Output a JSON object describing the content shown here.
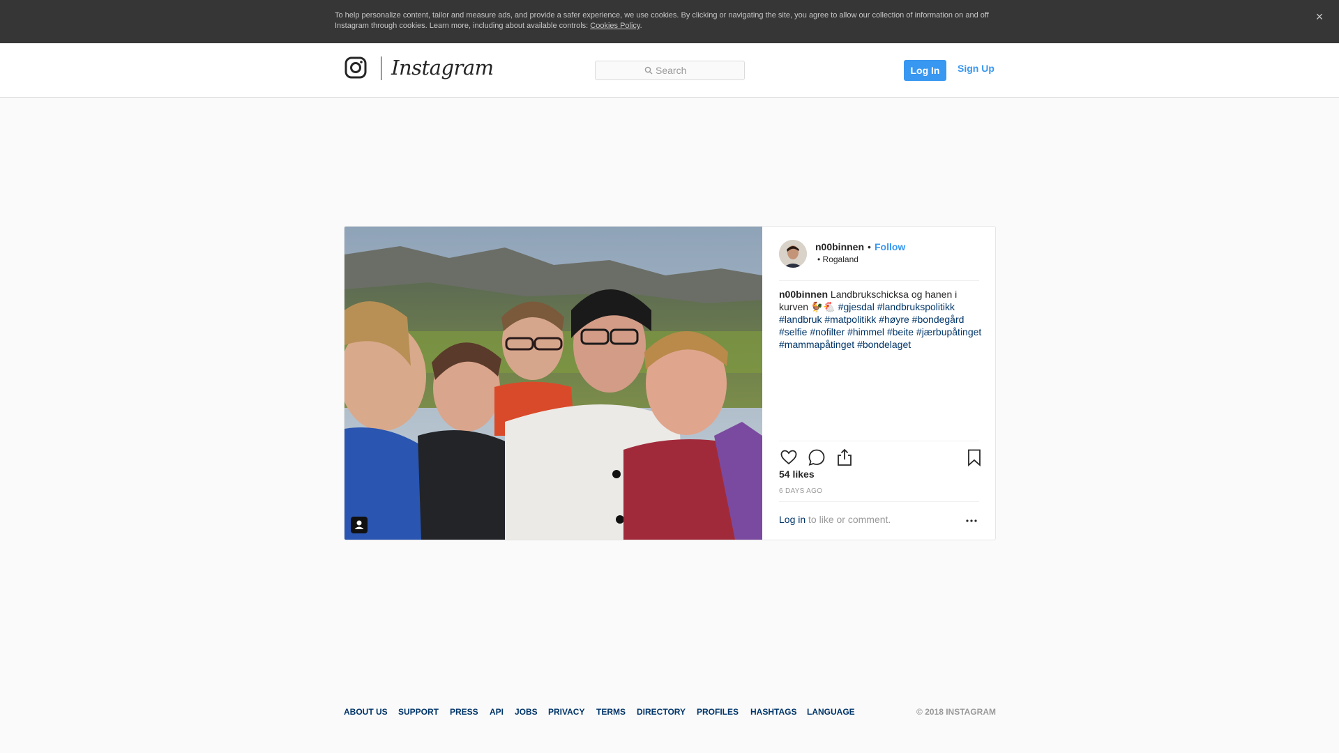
{
  "cookie_banner": {
    "text": "To help personalize content, tailor and measure ads, and provide a safer experience, we use cookies. By clicking or navigating the site, you agree to allow our collection of information on and off Instagram through cookies. Learn more, including about available controls: ",
    "policy_link": "Cookies Policy",
    "period": ".",
    "close_glyph": "×"
  },
  "header": {
    "wordmark": "Instagram",
    "search_placeholder": "Search",
    "login_label": "Log In",
    "signup_label": "Sign Up"
  },
  "post": {
    "username": "n00binnen",
    "separator": "•",
    "follow_label": "Follow",
    "location": "• Rogaland",
    "caption": {
      "username": "n00binnen",
      "text": " Landbrukschicksa og hanen i kurven 🐓🐔 ",
      "hashtags": [
        "#gjesdal",
        "#landbrukspolitikk",
        "#landbruk",
        "#matpolitikk",
        "#høyre",
        "#bondegård",
        "#selfie",
        "#nofilter",
        "#himmel",
        "#beite",
        "#jærbupåtinget",
        "#mammapåtinget",
        "#bondelaget"
      ]
    },
    "likes": "54 likes",
    "time_ago": "6 DAYS AGO",
    "login_link": "Log in",
    "login_suffix": " to like or comment."
  },
  "footer": {
    "links": [
      "ABOUT US",
      "SUPPORT",
      "PRESS",
      "API",
      "JOBS",
      "PRIVACY",
      "TERMS",
      "DIRECTORY",
      "PROFILES",
      "HASHTAGS",
      "LANGUAGE"
    ],
    "copyright": "© 2018 INSTAGRAM"
  },
  "icons": {
    "logo": "instagram-glyph-icon",
    "search": "search-icon",
    "like": "heart-icon",
    "comment": "comment-icon",
    "share": "share-icon",
    "save": "bookmark-icon",
    "more": "more-options-icon",
    "tagged": "user-tag-icon"
  },
  "colors": {
    "accent": "#3897f0",
    "link_dark": "#003569",
    "banner_bg": "#363636"
  }
}
